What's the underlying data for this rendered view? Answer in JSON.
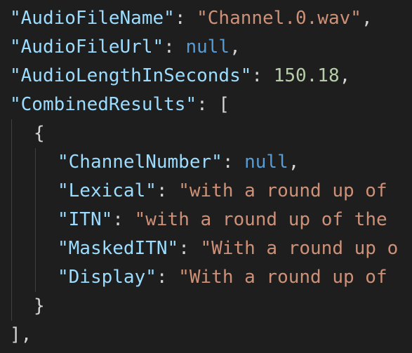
{
  "lines": {
    "l1": {
      "key": "\"AudioFileName\"",
      "sep": ": ",
      "val": "\"Channel.0.wav\"",
      "end": ","
    },
    "l2": {
      "key": "\"AudioFileUrl\"",
      "sep": ": ",
      "val": "null",
      "end": ","
    },
    "l3": {
      "key": "\"AudioLengthInSeconds\"",
      "sep": ": ",
      "val": "150.18",
      "end": ","
    },
    "l4": {
      "key": "\"CombinedResults\"",
      "sep": ": ",
      "open": "["
    },
    "l5": {
      "open": "{"
    },
    "l6": {
      "key": "\"ChannelNumber\"",
      "sep": ": ",
      "val": "null",
      "end": ","
    },
    "l7": {
      "key": "\"Lexical\"",
      "sep": ": ",
      "val": "\"with a round up of"
    },
    "l8": {
      "key": "\"ITN\"",
      "sep": ": ",
      "val": "\"with a round up of the"
    },
    "l9": {
      "key": "\"MaskedITN\"",
      "sep": ": ",
      "val": "\"With a round up o"
    },
    "l10": {
      "key": "\"Display\"",
      "sep": ": ",
      "val": "\"With a round up of"
    },
    "l11": {
      "close": "}"
    },
    "l12": {
      "close": "]",
      "end": ","
    }
  },
  "colors": {
    "background": "#1e1e1e",
    "key": "#9cdcfe",
    "string": "#ce9178",
    "number": "#b5cea8",
    "keyword": "#569cd6",
    "punctuation": "#d4d4d4",
    "indent_guide": "#404040"
  }
}
